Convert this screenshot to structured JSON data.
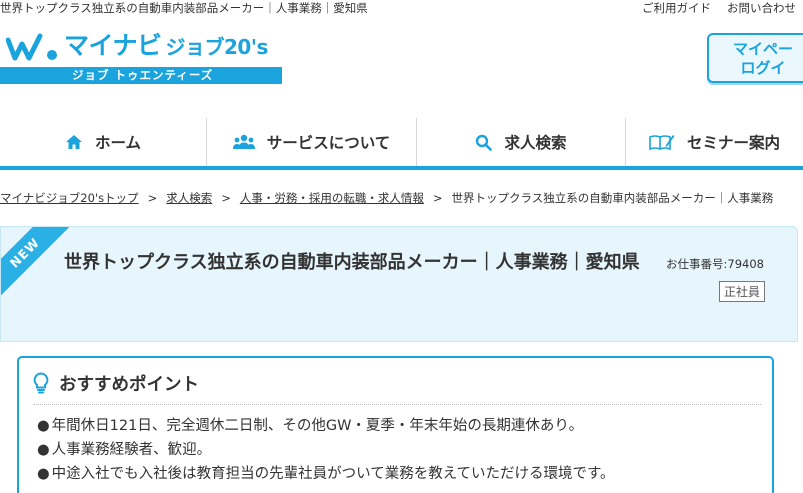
{
  "header": {
    "top_title": "世界トップクラス独立系の自動車内装部品メーカー｜人事業務｜愛知県",
    "util_links": [
      "ご利用ガイド",
      "お問い合わせ"
    ],
    "logo_brand": "マイナビ",
    "logo_sub": "ジョブ20's",
    "logo_bar_text": "ジョブ トゥエンティーズ",
    "mypage_label_1": "マイペー",
    "mypage_label_2": "ログイ"
  },
  "nav": [
    {
      "label": "ホーム",
      "icon": "home-icon"
    },
    {
      "label": "サービスについて",
      "icon": "users-icon"
    },
    {
      "label": "求人検索",
      "icon": "search-icon"
    },
    {
      "label": "セミナー案内",
      "icon": "book-pen-icon"
    }
  ],
  "breadcrumb": [
    "マイナビジョブ20'sトップ",
    "求人検索",
    "人事・労務・採用の転職・求人情報",
    "世界トップクラス独立系の自動車内装部品メーカー｜人事業務"
  ],
  "job": {
    "badge_new": "NEW",
    "title": "世界トップクラス独立系の自動車内装部品メーカー｜人事業務｜愛知県",
    "job_number": "お仕事番号:79408",
    "employment_type": "正社員"
  },
  "recommend": {
    "heading": "おすすめポイント",
    "items": [
      "年間休日121日、完全週休二日制、その他GW・夏季・年末年始の長期連休あり。",
      "人事業務経験者、歓迎。",
      "中途入社でも入社後は教育担当の先輩社員がついて業務を教えていただける環境です。"
    ]
  },
  "colors": {
    "brand_blue": "#1aa3dd",
    "header_bg": "#e6f6fc"
  }
}
